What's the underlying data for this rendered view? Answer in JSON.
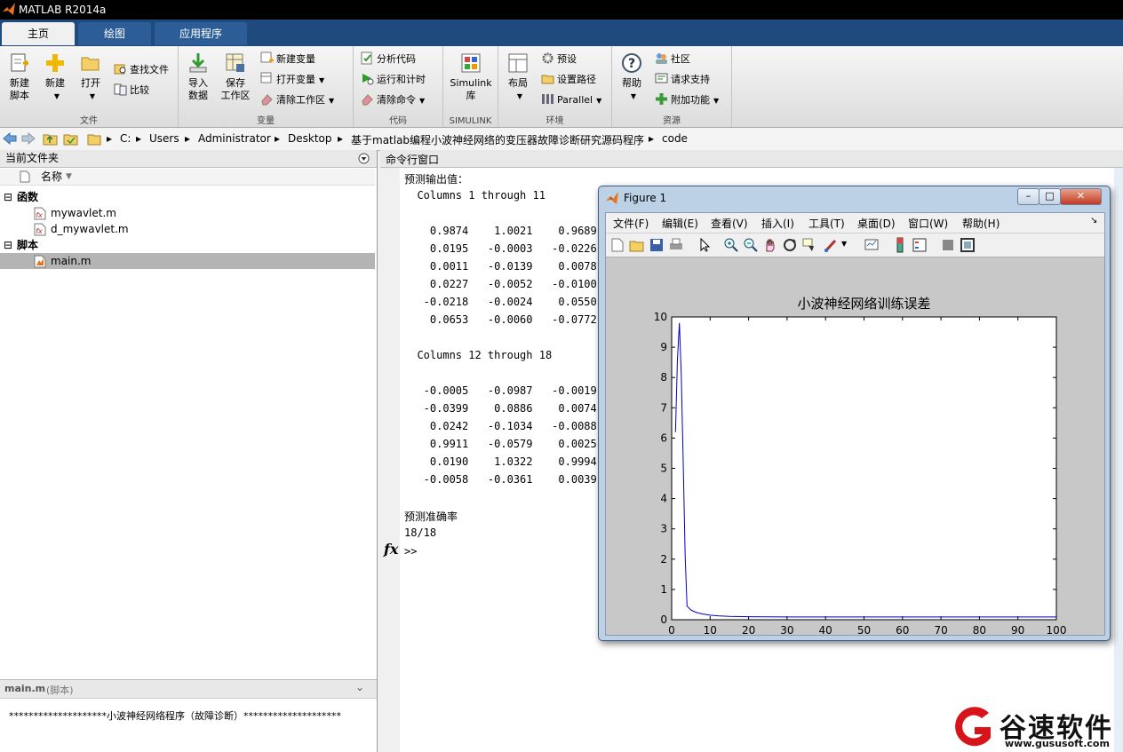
{
  "app": {
    "title": "MATLAB R2014a"
  },
  "tabs": [
    {
      "label": "主页"
    },
    {
      "label": "绘图"
    },
    {
      "label": "应用程序"
    }
  ],
  "ribbon": {
    "file": {
      "label": "文件",
      "new_script": "新建\n脚本",
      "new_script_l1": "新建",
      "new_script_l2": "脚本",
      "new": "新建",
      "open": "打开",
      "find_files": "查找文件",
      "compare": "比较"
    },
    "variable": {
      "label": "变量",
      "import_l1": "导入",
      "import_l2": "数据",
      "save_l1": "保存",
      "save_l2": "工作区",
      "new_var": "新建变量",
      "open_var": "打开变量",
      "clear_ws": "清除工作区"
    },
    "code": {
      "label": "代码",
      "analyze": "分析代码",
      "run_time": "运行和计时",
      "clear_cmd": "清除命令"
    },
    "simulink": {
      "label": "SIMULINK",
      "lib_l1": "Simulink",
      "lib_l2": "库"
    },
    "environment": {
      "label": "环境",
      "layout": "布局",
      "prefs": "预设",
      "set_path": "设置路径",
      "parallel": "Parallel"
    },
    "resources": {
      "label": "资源",
      "help": "帮助",
      "community": "社区",
      "support": "请求支持",
      "addons": "附加功能"
    }
  },
  "address": {
    "path": [
      "C:",
      "Users",
      "Administrator",
      "Desktop",
      "基于matlab编程小波神经网络的变压器故障诊断研究源码程序",
      "code"
    ]
  },
  "current_folder": {
    "title": "当前文件夹",
    "column_name": "名称",
    "groups": [
      {
        "label": "函数",
        "files": [
          "mywavlet.m",
          "d_mywavlet.m"
        ]
      },
      {
        "label": "脚本",
        "files": [
          "main.m"
        ]
      }
    ],
    "detail_title": "main.m",
    "detail_kind": "(脚本)",
    "detail_text": "********************小波神经网络程序（故障诊断）********************"
  },
  "command_window": {
    "title": "命令行窗口",
    "lines": [
      "预测输出值：",
      "  Columns 1 through 11",
      "",
      "    0.9874    1.0021    0.9689",
      "    0.0195   -0.0003   -0.0226",
      "    0.0011   -0.0139    0.0078",
      "    0.0227   -0.0052   -0.0100",
      "   -0.0218   -0.0024    0.0550",
      "    0.0653   -0.0060   -0.0772",
      "",
      "  Columns 12 through 18",
      "",
      "   -0.0005   -0.0987   -0.0019",
      "   -0.0399    0.0886    0.0074",
      "    0.0242   -0.1034   -0.0088",
      "    0.9911   -0.0579    0.0025",
      "    0.0190    1.0322    0.9994",
      "   -0.0058   -0.0361    0.0039",
      "",
      "预测准确率",
      "18/18"
    ],
    "fx": "fx",
    "prompt": ">>"
  },
  "figure": {
    "title": "Figure 1",
    "menu": [
      "文件(F)",
      "编辑(E)",
      "查看(V)",
      "插入(I)",
      "工具(T)",
      "桌面(D)",
      "窗口(W)",
      "帮助(H)"
    ]
  },
  "chart_data": {
    "type": "line",
    "title": "小波神经网络训练误差",
    "xlabel": "",
    "ylabel": "",
    "xlim": [
      0,
      100
    ],
    "ylim": [
      0,
      10
    ],
    "xticks": [
      0,
      10,
      20,
      30,
      40,
      50,
      60,
      70,
      80,
      90,
      100
    ],
    "yticks": [
      0,
      1,
      2,
      3,
      4,
      5,
      6,
      7,
      8,
      9,
      10
    ],
    "line_color": "#0000c0",
    "grid": false,
    "x": [
      1,
      1.5,
      2,
      2.5,
      3,
      3.5,
      4,
      5,
      6,
      7,
      8,
      10,
      12,
      15,
      20,
      30,
      40,
      50,
      60,
      70,
      80,
      90,
      100
    ],
    "y": [
      6.2,
      8.6,
      9.8,
      8.1,
      5.2,
      2.1,
      0.45,
      0.32,
      0.26,
      0.22,
      0.19,
      0.15,
      0.13,
      0.11,
      0.1,
      0.09,
      0.09,
      0.09,
      0.09,
      0.09,
      0.09,
      0.09,
      0.09
    ]
  },
  "watermark": {
    "brand": "谷速软件",
    "url": "www.gususoft.com"
  }
}
